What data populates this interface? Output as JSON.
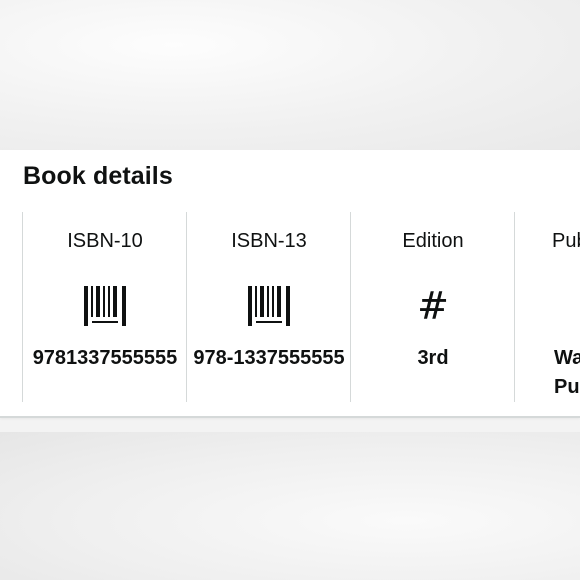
{
  "section": {
    "title": "Book details"
  },
  "cards": [
    {
      "label": "ISBN-10",
      "icon": "barcode-icon",
      "value": "9781337555555"
    },
    {
      "label": "ISBN-13",
      "icon": "barcode-icon",
      "value": "978-1337555555"
    },
    {
      "label": "Edition",
      "icon": "hash-icon",
      "value": "3rd"
    },
    {
      "label": "Publisher",
      "icon": "building-icon",
      "value": "Wadsworth Publishing"
    }
  ],
  "colors": {
    "text": "#0f1111",
    "divider": "#d5d9d9",
    "panel_background": "#ffffff"
  }
}
